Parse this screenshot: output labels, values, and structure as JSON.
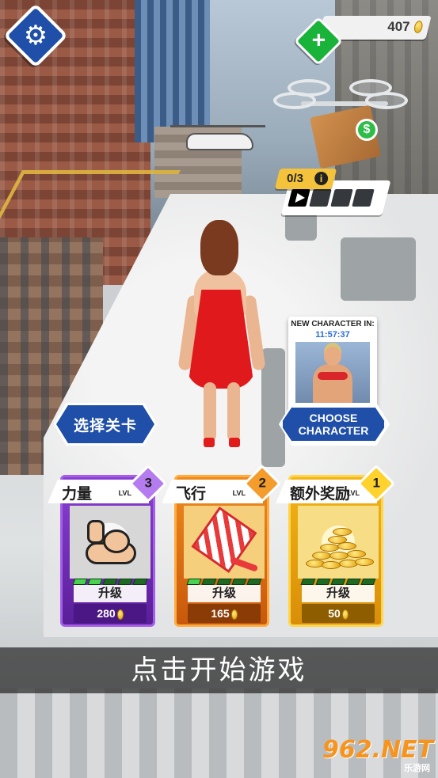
{
  "hud": {
    "settings_icon": "gear-icon",
    "coins": "407",
    "add_icon": "plus-icon"
  },
  "ad_reward": {
    "counter": "0/3",
    "info_icon": "info-icon",
    "progress_done": 0,
    "progress_total": 4
  },
  "new_character": {
    "label": "NEW CHARACTER IN:",
    "timer": "11:57:37"
  },
  "buttons": {
    "choose_character": "CHOOSE\nCHARACTER",
    "select_level": "选择关卡"
  },
  "upgrades": [
    {
      "name": "力量",
      "lvl_label": "LVL",
      "level": "3",
      "bars_filled": 2,
      "bars_total": 5,
      "action": "升级",
      "price": "280"
    },
    {
      "name": "飞行",
      "lvl_label": "LVL",
      "level": "2",
      "bars_filled": 1,
      "bars_total": 5,
      "action": "升级",
      "price": "165"
    },
    {
      "name": "额外奖励",
      "lvl_label": "LVL",
      "level": "1",
      "bars_filled": 0,
      "bars_total": 5,
      "action": "升级",
      "price": "50"
    }
  ],
  "caption": "点击开始游戏",
  "watermark": {
    "logo": "962.NET",
    "sub": "乐游网"
  },
  "colors": {
    "accent_blue": "#1f4fa8",
    "green": "#19b33a",
    "purple": "#8a3fd4",
    "orange": "#ef8b1d",
    "gold": "#f2b416"
  }
}
